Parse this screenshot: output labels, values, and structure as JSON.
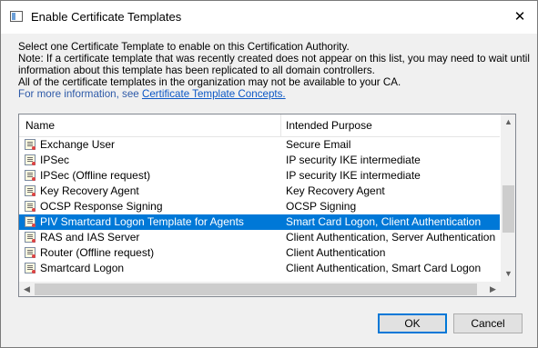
{
  "window": {
    "title": "Enable Certificate Templates",
    "close_glyph": "✕"
  },
  "description": {
    "line1": "Select one Certificate Template to enable on this Certification Authority.",
    "line2": "Note: If a certificate template that was recently created does not appear on this list, you may need to wait until",
    "line3": "information about this template has been replicated to all domain controllers.",
    "line4": "All of the certificate templates in the organization may not be available to your CA.",
    "link_prefix": "For more information, see ",
    "link_text": "Certificate Template Concepts.",
    "link_color": "#0b57c5"
  },
  "list": {
    "columns": {
      "name": "Name",
      "purpose": "Intended Purpose"
    },
    "rows": [
      {
        "name": "Exchange User",
        "purpose": "Secure Email",
        "icon": "certificate-template-icon"
      },
      {
        "name": "IPSec",
        "purpose": "IP security IKE intermediate",
        "icon": "certificate-template-icon"
      },
      {
        "name": "IPSec (Offline request)",
        "purpose": "IP security IKE intermediate",
        "icon": "certificate-template-icon"
      },
      {
        "name": "Key Recovery Agent",
        "purpose": "Key Recovery Agent",
        "icon": "certificate-template-icon"
      },
      {
        "name": "OCSP Response Signing",
        "purpose": "OCSP Signing",
        "icon": "certificate-template-icon"
      },
      {
        "name": "PIV Smartcard Logon Template for Agents",
        "purpose": "Smart Card Logon, Client Authentication",
        "icon": "certificate-template-icon",
        "selected": true
      },
      {
        "name": "RAS and IAS Server",
        "purpose": "Client Authentication, Server Authentication",
        "icon": "certificate-template-icon"
      },
      {
        "name": "Router (Offline request)",
        "purpose": "Client Authentication",
        "icon": "certificate-template-icon"
      },
      {
        "name": "Smartcard Logon",
        "purpose": "Client Authentication, Smart Card Logon",
        "icon": "certificate-template-icon"
      }
    ],
    "selection_color": "#0078d7",
    "vscroll": {
      "up_glyph": "▲",
      "down_glyph": "▼"
    },
    "hscroll": {
      "left_glyph": "◀",
      "right_glyph": "▶"
    }
  },
  "buttons": {
    "ok": "OK",
    "cancel": "Cancel"
  }
}
